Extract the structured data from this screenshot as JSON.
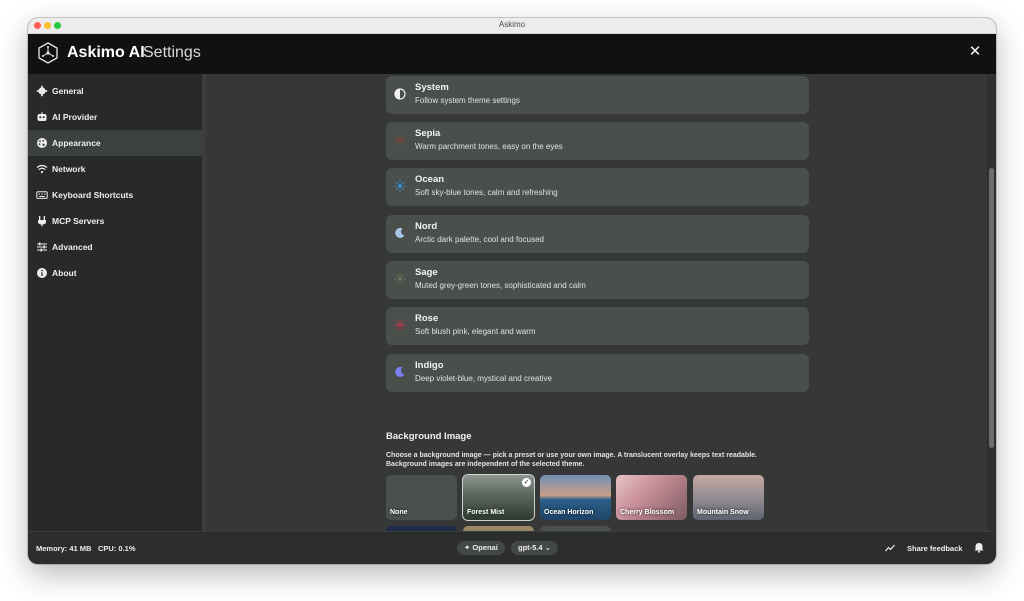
{
  "window": {
    "title": "Askimo"
  },
  "header": {
    "app_name": "Askimo AI",
    "section": "Settings",
    "close": "✕"
  },
  "sidebar": {
    "items": [
      {
        "label": "General",
        "icon": "gear-icon"
      },
      {
        "label": "AI Provider",
        "icon": "robot-icon"
      },
      {
        "label": "Appearance",
        "icon": "palette-icon",
        "active": true
      },
      {
        "label": "Network",
        "icon": "wifi-icon"
      },
      {
        "label": "Keyboard Shortcuts",
        "icon": "keyboard-icon"
      },
      {
        "label": "MCP Servers",
        "icon": "plug-icon"
      },
      {
        "label": "Advanced",
        "icon": "sliders-icon"
      },
      {
        "label": "About",
        "icon": "info-icon"
      }
    ]
  },
  "themes": [
    {
      "name": "System",
      "desc": "Follow system theme settings",
      "icon": "half-circle-icon",
      "color": "#f0f0f0"
    },
    {
      "name": "Sepia",
      "desc": "Warm parchment tones, easy on the eyes",
      "icon": "sun-icon",
      "color": "#7a4a35"
    },
    {
      "name": "Ocean",
      "desc": "Soft sky-blue tones, calm and refreshing",
      "icon": "sun-icon",
      "color": "#3a8fd6"
    },
    {
      "name": "Nord",
      "desc": "Arctic dark palette, cool and focused",
      "icon": "moon-icon",
      "color": "#a7c7e7"
    },
    {
      "name": "Sage",
      "desc": "Muted grey-green tones, sophisticated and calm",
      "icon": "sun-icon",
      "color": "#5f7a5a"
    },
    {
      "name": "Rose",
      "desc": "Soft blush pink, elegant and warm",
      "icon": "sun-icon",
      "color": "#c2334a"
    },
    {
      "name": "Indigo",
      "desc": "Deep violet-blue, mystical and creative",
      "icon": "moon-icon",
      "color": "#7b7ff2"
    }
  ],
  "background": {
    "heading": "Background Image",
    "desc_line1": "Choose a background image — pick a preset or use your own image. A translucent overlay keeps text readable.",
    "desc_line2": "Background images are independent of the selected theme.",
    "presets": [
      {
        "label": "None"
      },
      {
        "label": "Forest Mist",
        "selected": true
      },
      {
        "label": "Ocean Horizon"
      },
      {
        "label": "Cherry Blossom"
      },
      {
        "label": "Mountain Snow"
      }
    ]
  },
  "status": {
    "memory": "Memory: 41 MB",
    "cpu": "CPU: 0.1%",
    "provider": "Openai",
    "model": "gpt-5.4",
    "feedback": "Share feedback"
  }
}
